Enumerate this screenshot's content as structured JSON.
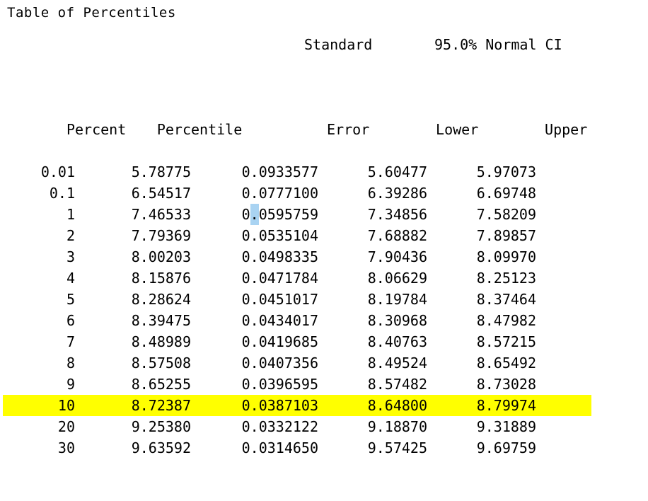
{
  "report": {
    "title": "Table of Percentiles",
    "header_top": {
      "standard": "Standard",
      "confidence": "95.0% Normal CI"
    },
    "columns": [
      {
        "key": "percent",
        "label": "Percent"
      },
      {
        "key": "percentile",
        "label": "Percentile"
      },
      {
        "key": "error",
        "label": "Error"
      },
      {
        "key": "lower",
        "label": "Lower"
      },
      {
        "key": "upper",
        "label": "Upper"
      }
    ],
    "highlight_color": "#ffff00",
    "selection_color": "#a9d3f2",
    "rows": [
      {
        "percent": "0.01",
        "percentile": "5.78775",
        "error": "0.0933577",
        "lower": "5.60477",
        "upper": "5.97073",
        "highlighted": false
      },
      {
        "percent": "0.1",
        "percentile": "6.54517",
        "error": "0.0777100",
        "lower": "6.39286",
        "upper": "6.69748",
        "highlighted": false
      },
      {
        "percent": "1",
        "percentile": "7.46533",
        "error": "0.0595759",
        "lower": "7.34856",
        "upper": "7.58209",
        "highlighted": false,
        "selected_char_index": 1
      },
      {
        "percent": "2",
        "percentile": "7.79369",
        "error": "0.0535104",
        "lower": "7.68882",
        "upper": "7.89857",
        "highlighted": false
      },
      {
        "percent": "3",
        "percentile": "8.00203",
        "error": "0.0498335",
        "lower": "7.90436",
        "upper": "8.09970",
        "highlighted": false
      },
      {
        "percent": "4",
        "percentile": "8.15876",
        "error": "0.0471784",
        "lower": "8.06629",
        "upper": "8.25123",
        "highlighted": false
      },
      {
        "percent": "5",
        "percentile": "8.28624",
        "error": "0.0451017",
        "lower": "8.19784",
        "upper": "8.37464",
        "highlighted": false
      },
      {
        "percent": "6",
        "percentile": "8.39475",
        "error": "0.0434017",
        "lower": "8.30968",
        "upper": "8.47982",
        "highlighted": false
      },
      {
        "percent": "7",
        "percentile": "8.48989",
        "error": "0.0419685",
        "lower": "8.40763",
        "upper": "8.57215",
        "highlighted": false
      },
      {
        "percent": "8",
        "percentile": "8.57508",
        "error": "0.0407356",
        "lower": "8.49524",
        "upper": "8.65492",
        "highlighted": false
      },
      {
        "percent": "9",
        "percentile": "8.65255",
        "error": "0.0396595",
        "lower": "8.57482",
        "upper": "8.73028",
        "highlighted": false
      },
      {
        "percent": "10",
        "percentile": "8.72387",
        "error": "0.0387103",
        "lower": "8.64800",
        "upper": "8.79974",
        "highlighted": true
      },
      {
        "percent": "20",
        "percentile": "9.25380",
        "error": "0.0332122",
        "lower": "9.18870",
        "upper": "9.31889",
        "highlighted": false
      },
      {
        "percent": "30",
        "percentile": "9.63592",
        "error": "0.0314650",
        "lower": "9.57425",
        "upper": "9.69759",
        "highlighted": false
      }
    ]
  },
  "chart_data": {
    "type": "table",
    "title": "Table of Percentiles",
    "columns": [
      "Percent",
      "Percentile",
      "Standard Error",
      "95.0% Normal CI Lower",
      "95.0% Normal CI Upper"
    ],
    "rows": [
      [
        "0.01",
        "5.78775",
        "0.0933577",
        "5.60477",
        "5.97073"
      ],
      [
        "0.1",
        "6.54517",
        "0.0777100",
        "6.39286",
        "6.69748"
      ],
      [
        "1",
        "7.46533",
        "0.0595759",
        "7.34856",
        "7.58209"
      ],
      [
        "2",
        "7.79369",
        "0.0535104",
        "7.68882",
        "7.89857"
      ],
      [
        "3",
        "8.00203",
        "0.0498335",
        "7.90436",
        "8.09970"
      ],
      [
        "4",
        "8.15876",
        "0.0471784",
        "8.06629",
        "8.25123"
      ],
      [
        "5",
        "8.28624",
        "0.0451017",
        "8.19784",
        "8.37464"
      ],
      [
        "6",
        "8.39475",
        "0.0434017",
        "8.30968",
        "8.47982"
      ],
      [
        "7",
        "8.48989",
        "0.0419685",
        "8.40763",
        "8.57215"
      ],
      [
        "8",
        "8.57508",
        "0.0407356",
        "8.49524",
        "8.65492"
      ],
      [
        "9",
        "8.65255",
        "0.0396595",
        "8.57482",
        "8.73028"
      ],
      [
        "10",
        "8.72387",
        "0.0387103",
        "8.64800",
        "8.79974"
      ],
      [
        "20",
        "9.25380",
        "0.0332122",
        "9.18870",
        "9.31889"
      ],
      [
        "30",
        "9.63592",
        "0.0314650",
        "9.57425",
        "9.69759"
      ]
    ],
    "highlighted_row_index": 11
  }
}
